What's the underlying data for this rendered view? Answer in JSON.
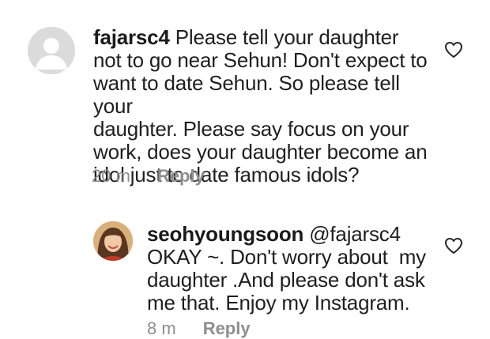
{
  "comments": [
    {
      "username": "fajarsc4",
      "mention": "",
      "lines": [
        "Please tell your daughter",
        "not to go near Sehun! Don't expect to",
        "want to date Sehun. So please tell your",
        "daughter. Please say focus on your",
        "work, does your daughter become an",
        "idol just to date famous idols?"
      ],
      "time": "20 m",
      "reply_label": "Reply",
      "avatar_icon": "default-user-avatar-icon",
      "like_icon": "heart-outline-icon"
    },
    {
      "username": "seohyoungsoon",
      "mention": "@fajarsc4",
      "lines": [
        "OKAY ~. Don't worry about  my",
        "daughter .And please don't ask",
        "me that. Enjoy my Instagram."
      ],
      "time": "8 m",
      "reply_label": "Reply",
      "avatar_icon": "profile-photo-avatar",
      "like_icon": "heart-outline-icon"
    }
  ],
  "colors": {
    "text": "#1f1f1f",
    "muted": "#8e8e8e",
    "default_avatar": "#dbdbdb"
  }
}
